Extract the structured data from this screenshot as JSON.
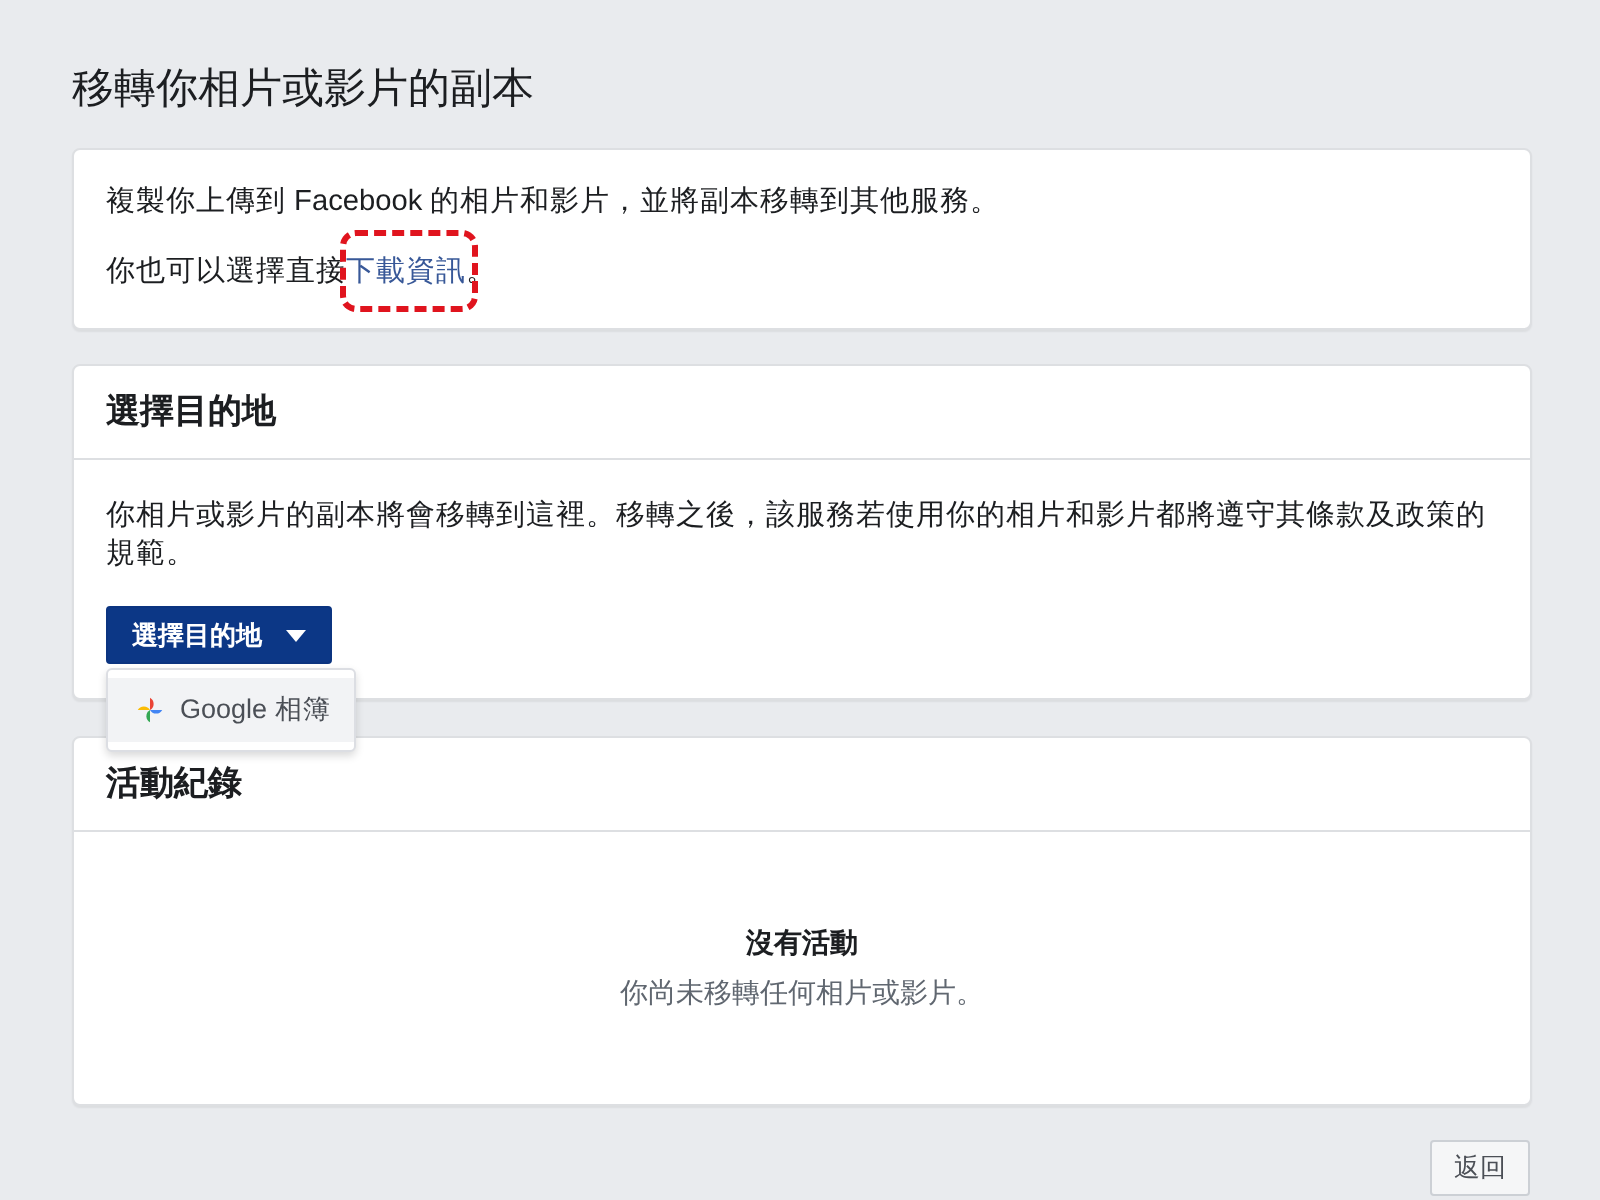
{
  "page": {
    "title": "移轉你相片或影片的副本"
  },
  "intro_card": {
    "text": "複製你上傳到 Facebook 的相片和影片，並將副本移轉到其他服務。",
    "note_before": "你也可以選擇直接",
    "link": {
      "label": "下載資訊",
      "highlighted": true
    },
    "note_after": "。"
  },
  "destination_card": {
    "heading": "選擇目的地",
    "text": "你相片或影片的副本將會移轉到這裡。移轉之後，該服務若使用你的相片和影片都將遵守其條款及政策的規範。",
    "dropdown": {
      "label": "選擇目的地",
      "expanded": true,
      "options": [
        {
          "label": "Google 相簿",
          "highlighted": true
        }
      ]
    }
  },
  "activity_card": {
    "heading": "活動紀錄",
    "empty_title": "沒有活動",
    "empty_text": "你尚未移轉任何相片或影片。"
  },
  "footer": {
    "back_button": "返回"
  }
}
